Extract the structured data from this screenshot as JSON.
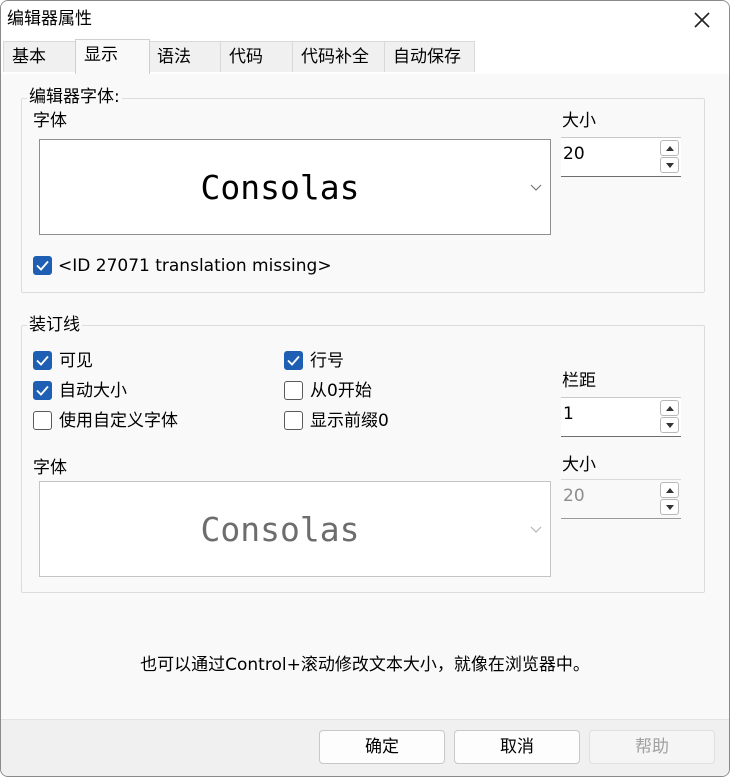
{
  "window": {
    "title": "编辑器属性"
  },
  "tabs": [
    {
      "label": "基本"
    },
    {
      "label": "显示"
    },
    {
      "label": "语法"
    },
    {
      "label": "代码"
    },
    {
      "label": "代码补全"
    },
    {
      "label": "自动保存"
    }
  ],
  "active_tab": "显示",
  "editor_font": {
    "group_title": "编辑器字体:",
    "font_label": "字体",
    "font_value": "Consolas",
    "size_label": "大小",
    "size_value": "20",
    "option_label": "<ID 27071 translation missing>",
    "option_checked": true
  },
  "gutter": {
    "group_title": "装订线",
    "visible_label": "可见",
    "visible_checked": true,
    "line_numbers_label": "行号",
    "line_numbers_checked": true,
    "auto_size_label": "自动大小",
    "auto_size_checked": true,
    "start_zero_label": "从0开始",
    "start_zero_checked": false,
    "custom_font_label": "使用自定义字体",
    "custom_font_checked": false,
    "leading_zero_label": "显示前缀0",
    "leading_zero_checked": false,
    "spacing_label": "栏距",
    "spacing_value": "1",
    "font_label": "字体",
    "font_value": "Consolas",
    "size_label": "大小",
    "size_value": "20"
  },
  "hint": "也可以通过Control+滚动修改文本大小，就像在浏览器中。",
  "buttons": {
    "ok": "确定",
    "cancel": "取消",
    "help": "帮助"
  }
}
